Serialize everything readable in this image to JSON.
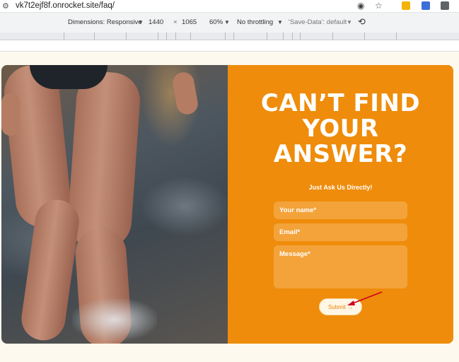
{
  "browser": {
    "url": "vk7t2ejf8f.onrocket.site/faq/"
  },
  "devtools": {
    "dimensions_label": "Dimensions: Responsive",
    "width": "1440",
    "times": "×",
    "height": "1065",
    "zoom": "60%",
    "throttling": "No throttling",
    "save_data": "'Save-Data': default"
  },
  "cta": {
    "heading_lines": [
      "CAN’T FIND",
      "YOUR",
      "ANSWER?"
    ],
    "subheading": "Just Ask Us Directly!",
    "name_placeholder": "Your name*",
    "email_placeholder": "Email*",
    "message_placeholder": "Message*",
    "submit_label": "Submit →"
  },
  "colors": {
    "accent": "#ef8c0b",
    "field": "#f3a33a",
    "page_bg": "#fdf9ee",
    "annotation_arrow": "#d0021b"
  },
  "icons": [
    "site-settings-icon",
    "hide-eye-icon",
    "bookmark-star-icon",
    "extension-icon",
    "rotate-icon"
  ]
}
